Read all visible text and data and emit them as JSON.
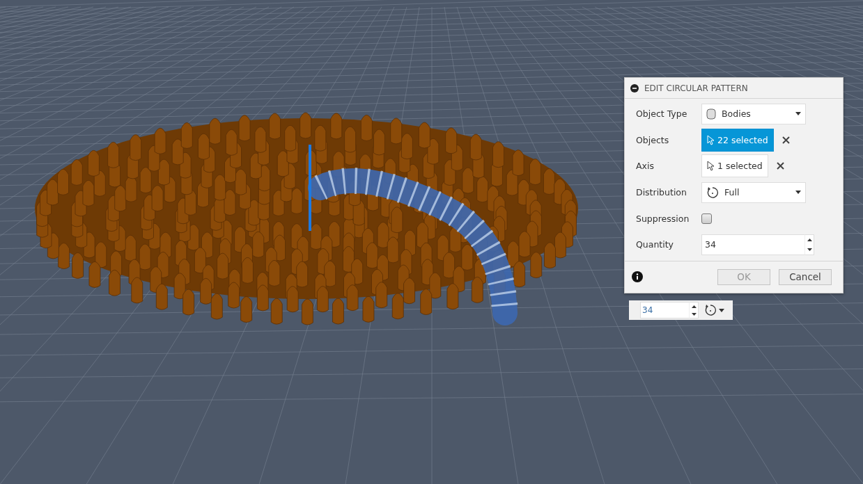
{
  "dialog": {
    "title": "EDIT CIRCULAR PATTERN",
    "fields": [
      {
        "kind": "dropdown",
        "label": "Object Type",
        "value": "Bodies"
      },
      {
        "kind": "selection",
        "label": "Objects",
        "value": "22 selected",
        "selected": true
      },
      {
        "kind": "selection",
        "label": "Axis",
        "value": "1 selected",
        "selected": false
      },
      {
        "kind": "dropdown",
        "label": "Distribution",
        "value": "Full"
      },
      {
        "kind": "checkbox",
        "label": "Suppression",
        "checked": false
      },
      {
        "kind": "spinner",
        "label": "Quantity",
        "value": "34"
      }
    ],
    "buttons": [
      {
        "label": "OK",
        "disabled": true
      },
      {
        "label": "Cancel",
        "disabled": false
      }
    ]
  },
  "mini_toolbar": {
    "quantity": "34"
  }
}
